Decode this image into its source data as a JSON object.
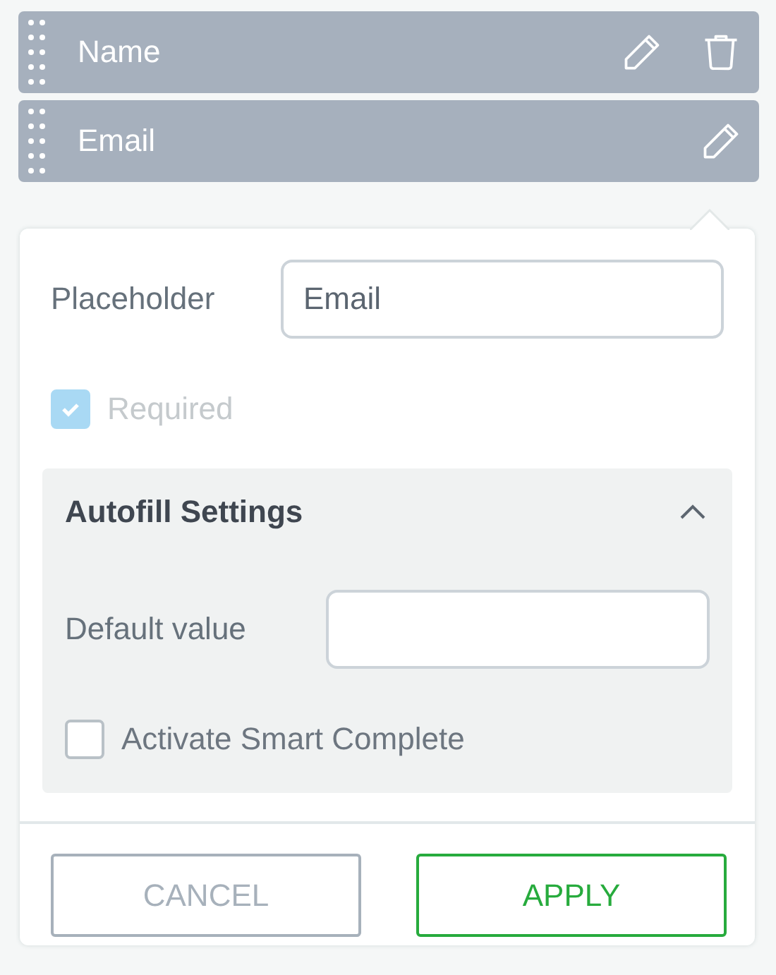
{
  "fields": [
    {
      "label": "Name",
      "editable": true,
      "deletable": true
    },
    {
      "label": "Email",
      "editable": true,
      "deletable": false
    }
  ],
  "popover": {
    "placeholder_field": {
      "label": "Placeholder",
      "value": "Email"
    },
    "required": {
      "label": "Required",
      "checked": true,
      "disabled": true
    },
    "autofill": {
      "title": "Autofill Settings",
      "expanded": true,
      "default_label": "Default value",
      "smart_complete": {
        "label": "Activate Smart Complete",
        "checked": false,
        "disabled": false
      }
    },
    "buttons": [
      {
        "label": "CANCEL",
        "kind": "secondary"
      },
      {
        "label": "APPLY",
        "kind": "primary"
      }
    ]
  }
}
